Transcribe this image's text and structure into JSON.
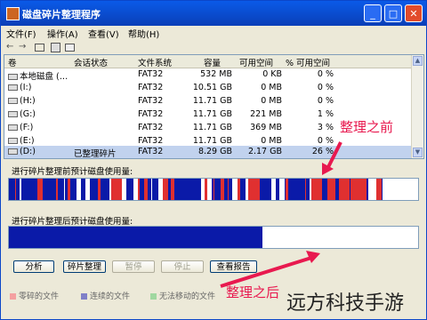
{
  "window": {
    "title": "磁盘碎片整理程序",
    "icon": "defrag-app-icon"
  },
  "window_buttons": {
    "min": "_",
    "max": "□",
    "close": "✕"
  },
  "menu": [
    "文件(F)",
    "操作(A)",
    "查看(V)",
    "帮助(H)"
  ],
  "toolbar": {
    "back": "←",
    "forward": "→",
    "icons": [
      "properties-icon",
      "help-icon",
      "console-icon"
    ]
  },
  "columns": [
    "卷",
    "会话状态",
    "文件系统",
    "容量",
    "可用空间",
    "% 可用空间"
  ],
  "volumes": [
    {
      "name": "本地磁盘 (…",
      "status": "",
      "fs": "FAT32",
      "capacity": "532 MB",
      "free": "0 KB",
      "pct": "0 %"
    },
    {
      "name": "(I:)",
      "status": "",
      "fs": "FAT32",
      "capacity": "10.51 GB",
      "free": "0 MB",
      "pct": "0 %"
    },
    {
      "name": "(H:)",
      "status": "",
      "fs": "FAT32",
      "capacity": "11.71 GB",
      "free": "0 MB",
      "pct": "0 %"
    },
    {
      "name": "(G:)",
      "status": "",
      "fs": "FAT32",
      "capacity": "11.71 GB",
      "free": "221 MB",
      "pct": "1 %"
    },
    {
      "name": "(F:)",
      "status": "",
      "fs": "FAT32",
      "capacity": "11.71 GB",
      "free": "369 MB",
      "pct": "3 %"
    },
    {
      "name": "(E:)",
      "status": "",
      "fs": "FAT32",
      "capacity": "11.71 GB",
      "free": "0 MB",
      "pct": "0 %"
    },
    {
      "name": "(D:)",
      "status": "已整理碎片",
      "fs": "FAT32",
      "capacity": "8.29 GB",
      "free": "2.17 GB",
      "pct": "26 %"
    }
  ],
  "before_label": "进行碎片整理前预计磁盘使用量:",
  "after_label": "进行碎片整理后预计磁盘使用量:",
  "after_usage_fraction": 0.62,
  "buttons": {
    "analyze": "分析",
    "defrag": "碎片整理",
    "pause": "暂停",
    "stop": "停止",
    "report": "查看报告"
  },
  "legend": [
    {
      "label": "零碎的文件",
      "color": "#e03030"
    },
    {
      "label": "连续的文件",
      "color": "#1a1aa0"
    },
    {
      "label": "无法移动的文件",
      "color": "#30a030"
    }
  ],
  "annotations": {
    "before": "整理之前",
    "after": "整理之后"
  },
  "watermark": "远方科技手游",
  "colors": {
    "fragmented": "#e03030",
    "contiguous": "#0a1aa8",
    "free": "#ffffff",
    "annotation": "#e8194f"
  }
}
